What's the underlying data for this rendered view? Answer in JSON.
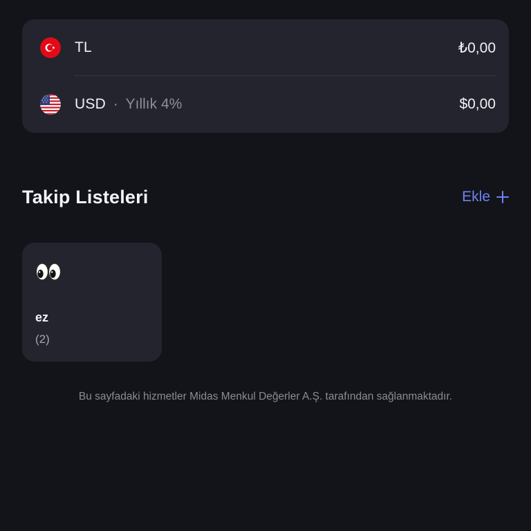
{
  "balances": [
    {
      "currency": "TL",
      "flag_icon": "turkey-flag-icon",
      "rate_label": "",
      "amount": "₺0,00"
    },
    {
      "currency": "USD",
      "flag_icon": "usa-flag-icon",
      "separator": "·",
      "rate_label": "Yıllık 4%",
      "amount": "$0,00"
    }
  ],
  "watchlists_section": {
    "title": "Takip Listeleri",
    "add_label": "Ekle",
    "add_icon": "plus-icon"
  },
  "watchlists": [
    {
      "emoji_icon": "eyes-emoji-icon",
      "name": "ez",
      "count": "(2)"
    }
  ],
  "footer": {
    "disclaimer": "Bu sayfadaki hizmetler Midas Menkul Değerler A.Ş. tarafından sağlanmaktadır."
  },
  "colors": {
    "background": "#131419",
    "card": "#23242E",
    "accent": "#6F82F5",
    "muted_text": "#8E8F9B"
  }
}
